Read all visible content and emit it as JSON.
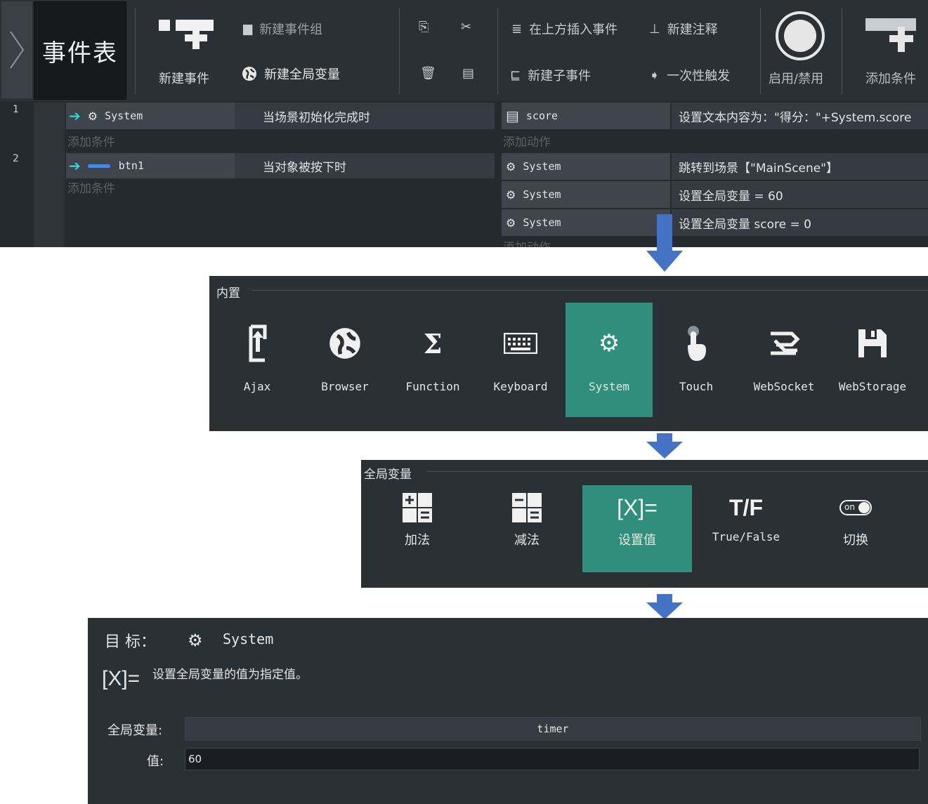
{
  "toolbar": {
    "title": "事件表",
    "new_event": "新建事件",
    "new_event_group": "新建事件组",
    "new_global_var": "新建全局变量",
    "insert_above": "在上方插入事件",
    "new_comment": "新建注释",
    "new_sub_event": "新建子事件",
    "trigger_once": "一次性触发",
    "enable_disable": "启用/禁用",
    "add_condition": "添加条件"
  },
  "events": [
    {
      "num": "1",
      "condition_object": "System",
      "condition_text": "当场景初始化完成时",
      "add_condition": "添加条件",
      "actions": [
        {
          "object": "score",
          "text": "设置文本内容为：\"得分：\"+System.score"
        }
      ],
      "add_action": "添加动作"
    },
    {
      "num": "2",
      "condition_object": "btn1",
      "condition_text": "当对象被按下时",
      "add_condition": "添加条件",
      "actions": [
        {
          "object": "System",
          "text": "跳转到场景【\"MainScene\"】"
        },
        {
          "object": "System",
          "text": "设置全局变量  = 60"
        },
        {
          "object": "System",
          "text": "设置全局变量 score = 0"
        }
      ],
      "add_action": "添加动作"
    }
  ],
  "builtin": {
    "group_title": "内置",
    "items": [
      {
        "label": "Ajax",
        "icon": "ajax-icon"
      },
      {
        "label": "Browser",
        "icon": "globe-icon"
      },
      {
        "label": "Function",
        "icon": "sigma-icon"
      },
      {
        "label": "Keyboard",
        "icon": "keyboard-icon"
      },
      {
        "label": "System",
        "icon": "gears-icon"
      },
      {
        "label": "Touch",
        "icon": "touch-icon"
      },
      {
        "label": "WebSocket",
        "icon": "websocket-icon"
      },
      {
        "label": "WebStorage",
        "icon": "save-icon"
      }
    ],
    "selected": "System"
  },
  "global_var": {
    "group_title": "全局变量",
    "items": [
      {
        "label": "加法",
        "icon": "add-icon"
      },
      {
        "label": "减法",
        "icon": "subtract-icon"
      },
      {
        "label": "设置值",
        "icon": "set-value-icon",
        "glyph": "[X]="
      },
      {
        "label": "True/False",
        "icon": "true-false-icon",
        "glyph": "T/F"
      },
      {
        "label": "切换",
        "icon": "toggle-icon",
        "glyph": "on"
      }
    ],
    "selected": "设置值"
  },
  "detail": {
    "target_label": "目 标：",
    "target_object": "System",
    "glyph": "[X]=",
    "description": "设置全局变量的值为指定值。",
    "var_label": "全局变量:",
    "var_value": "timer",
    "value_label": "值:",
    "value_value": "60"
  },
  "colors": {
    "selected_tile": "#2f8f7c",
    "arrow": "#4472c4",
    "condition_arrow": "#32d3d3"
  }
}
